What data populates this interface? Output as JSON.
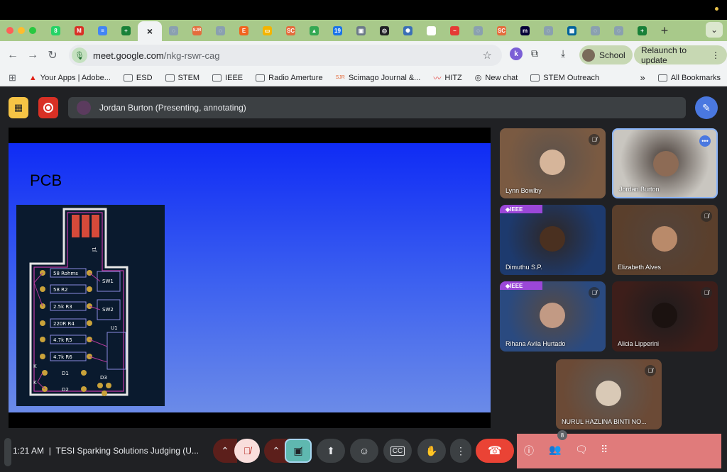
{
  "colors": {
    "tabstrip": "#a8c98a",
    "meet_bg": "#202124",
    "end_call": "#ea4335",
    "accent_pen": "#4a78e0",
    "overlay_pink": "#e07b7b"
  },
  "browser": {
    "tabs": [
      {
        "icon": "whatsapp-icon",
        "color": "#25d366",
        "glyph": "8"
      },
      {
        "icon": "gmail-icon",
        "color": "#d93025",
        "glyph": "M"
      },
      {
        "icon": "docs-icon",
        "color": "#4285f4",
        "glyph": "≡"
      },
      {
        "icon": "sheets-plus-icon",
        "color": "#188038",
        "glyph": "+"
      },
      {
        "icon": "close-icon",
        "color": "#f1f3f4",
        "glyph": "×",
        "active": true
      },
      {
        "icon": "globe-icon",
        "color": "#8aa0b0",
        "glyph": "◌"
      },
      {
        "icon": "sjr-icon",
        "color": "#e46c3c",
        "glyph": "SJR"
      },
      {
        "icon": "globe-icon",
        "color": "#8aa0b0",
        "glyph": "◌"
      },
      {
        "icon": "etsy-icon",
        "color": "#f1641e",
        "glyph": "E"
      },
      {
        "icon": "slides-icon",
        "color": "#f4b400",
        "glyph": "▭"
      },
      {
        "icon": "sc-icon",
        "color": "#e46c3c",
        "glyph": "SC"
      },
      {
        "icon": "drive-icon",
        "color": "#34a853",
        "glyph": "▲"
      },
      {
        "icon": "calendar-icon",
        "color": "#1a73e8",
        "glyph": "19"
      },
      {
        "icon": "contacts-icon",
        "color": "#6c7a89",
        "glyph": "▣"
      },
      {
        "icon": "openai-icon",
        "color": "#202124",
        "glyph": "◎"
      },
      {
        "icon": "gear-icon",
        "color": "#3b6fb6",
        "glyph": "✺"
      },
      {
        "icon": "scan-icon",
        "color": "#ffffff",
        "glyph": "▬"
      },
      {
        "icon": "hitz-icon",
        "color": "#e53935",
        "glyph": "~"
      },
      {
        "icon": "globe-icon",
        "color": "#8aa0b0",
        "glyph": "◌"
      },
      {
        "icon": "sc-icon",
        "color": "#e46c3c",
        "glyph": "SC"
      },
      {
        "icon": "miro-icon",
        "color": "#050038",
        "glyph": "m"
      },
      {
        "icon": "globe-icon",
        "color": "#8aa0b0",
        "glyph": "◌"
      },
      {
        "icon": "ieee-icon",
        "color": "#00629b",
        "glyph": "▦"
      },
      {
        "icon": "globe-icon",
        "color": "#8aa0b0",
        "glyph": "◌"
      },
      {
        "icon": "globe-icon",
        "color": "#8aa0b0",
        "glyph": "◌"
      },
      {
        "icon": "sheets-plus-icon",
        "color": "#188038",
        "glyph": "+"
      }
    ],
    "new_tab": "+",
    "url_host": "meet.google.com",
    "url_path": "/nkg-rswr-cag",
    "profile_letter": "k",
    "school_label": "School",
    "relaunch_label": "Relaunch to update",
    "bookmarks": [
      {
        "label": "Your Apps | Adobe...",
        "icon": "adobe-icon"
      },
      {
        "label": "ESD",
        "icon": "folder-icon"
      },
      {
        "label": "STEM",
        "icon": "folder-icon"
      },
      {
        "label": "IEEE",
        "icon": "folder-icon"
      },
      {
        "label": "Radio Amerture",
        "icon": "folder-icon"
      },
      {
        "label": "Scimago Journal &...",
        "icon": "sjr-icon"
      },
      {
        "label": "HITZ",
        "icon": "hitz-icon"
      },
      {
        "label": "New chat",
        "icon": "openai-icon"
      },
      {
        "label": "STEM Outreach",
        "icon": "folder-icon"
      }
    ],
    "more_bookmarks": "»",
    "all_bookmarks": "All Bookmarks"
  },
  "meet": {
    "presenter_bar": "Jordan Burton (Presenting, annotating)",
    "slide_title": "PCB",
    "pcb_labels": [
      "58 Rohms",
      "R1",
      "58 R2",
      "2.5k R3",
      "220R R4",
      "4.7k R5",
      "4.7k R6",
      "SW1",
      "SW2",
      "U1",
      "D1",
      "D2",
      "D3",
      "J1",
      "K",
      "K"
    ],
    "participants": [
      {
        "name": "Lynn Bowlby",
        "muted": true,
        "ieee": false,
        "bg": "#7a5a42",
        "face": "#d6b59a",
        "active": false
      },
      {
        "name": "Jordan Burton",
        "muted": false,
        "ieee": false,
        "bg": "#c9c6c0",
        "face": "#8d6b55",
        "active": true
      },
      {
        "name": "Dimuthu S.P.",
        "muted": false,
        "ieee": true,
        "bg": "#1d3a6e",
        "face": "#4a3020",
        "active": false
      },
      {
        "name": "Elizabeth Alves",
        "muted": true,
        "ieee": false,
        "bg": "#5a3f2c",
        "face": "#b98a6a",
        "active": false
      },
      {
        "name": "Rihana Avila Hurtado",
        "muted": true,
        "ieee": true,
        "bg": "#2a4a80",
        "face": "#c29a84",
        "active": false
      },
      {
        "name": "Alicia Lipperini",
        "muted": true,
        "ieee": false,
        "bg": "#3d1e1a",
        "face": "#1b1210",
        "active": false
      },
      {
        "name": "NURUL HAZLINA BINTI NO...",
        "muted": true,
        "ieee": false,
        "bg": "#6b4a36",
        "face": "#d9c9b6",
        "active": false
      }
    ],
    "ieee_badge": "◆IEEE",
    "clock": "1:21 AM",
    "separator": "|",
    "meeting_title": "TESI Sparking Solutions Judging (U...",
    "people_count": "8"
  }
}
